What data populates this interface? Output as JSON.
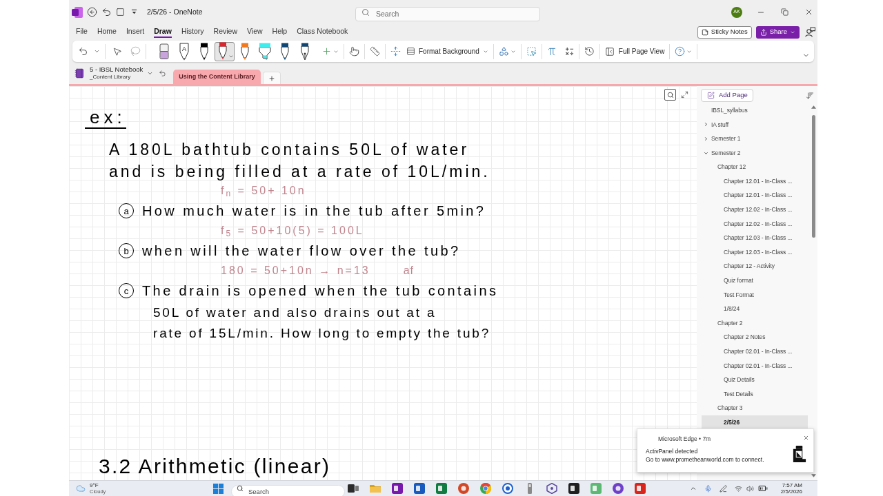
{
  "window": {
    "title": "2/5/26 - OneNote",
    "search_placeholder": "Search",
    "account_initials": "AK"
  },
  "menu_tabs": [
    {
      "label": "File",
      "selected": false
    },
    {
      "label": "Home",
      "selected": false
    },
    {
      "label": "Insert",
      "selected": false
    },
    {
      "label": "Draw",
      "selected": true
    },
    {
      "label": "History",
      "selected": false
    },
    {
      "label": "Review",
      "selected": false
    },
    {
      "label": "View",
      "selected": false
    },
    {
      "label": "Help",
      "selected": false
    },
    {
      "label": "Class Notebook",
      "selected": false
    }
  ],
  "header_buttons": {
    "sticky_notes": "Sticky Notes",
    "share": "Share"
  },
  "ribbon": {
    "pens": [
      {
        "kind": "eraser",
        "color": "#c9a3dc",
        "selected": false
      },
      {
        "kind": "text_pen",
        "label": "A",
        "selected": false
      },
      {
        "kind": "pen",
        "color": "#000000",
        "selected": false
      },
      {
        "kind": "pen",
        "color": "#e3232c",
        "selected": true
      },
      {
        "kind": "pen",
        "color": "#f07a1f",
        "selected": false
      },
      {
        "kind": "highlighter",
        "color": "#40ecec",
        "selected": false
      },
      {
        "kind": "pen",
        "color": "#0f4673",
        "selected": false
      },
      {
        "kind": "fountain_pen",
        "color": "#0f4673",
        "selected": false
      }
    ],
    "format_background": "Format Background",
    "full_page_view": "Full Page View"
  },
  "notebook": {
    "name": "5 - IBSL Notebook",
    "section_group": "_Content Library"
  },
  "section_tabs": [
    {
      "label": "Using the Content Library",
      "selected": true
    }
  ],
  "page_list": {
    "add_page": "Add Page",
    "items": [
      {
        "label": "IBSL_syllabus",
        "selected": false
      },
      {
        "label": "IA stuff",
        "selected": false,
        "expanded": false
      },
      {
        "label": "Semester 1",
        "selected": false,
        "expanded": false
      },
      {
        "label": "Semester 2",
        "selected": false,
        "expanded": true,
        "children": [
          {
            "label": "Chapter 12",
            "selected": false,
            "children": [
              {
                "label": "Chapter 12.01 - In-Class ...",
                "selected": false
              },
              {
                "label": "Chapter 12.01 - In-Class ...",
                "selected": false
              },
              {
                "label": "Chapter 12.02 - In-Class ...",
                "selected": false
              },
              {
                "label": "Chapter 12.02 - In-Class ...",
                "selected": false
              },
              {
                "label": "Chapter 12.03 - In-Class ...",
                "selected": false
              },
              {
                "label": "Chapter 12.03 - In-Class ...",
                "selected": false
              },
              {
                "label": "Chapter 12 - Activity",
                "selected": false
              },
              {
                "label": "Quiz format",
                "selected": false
              },
              {
                "label": "Test Format",
                "selected": false
              },
              {
                "label": "1/8/24",
                "selected": false
              }
            ]
          },
          {
            "label": "Chapter 2",
            "selected": false,
            "children": [
              {
                "label": "Chapter 2 Notes",
                "selected": false
              },
              {
                "label": "Chapter 02.01 - In-Class ...",
                "selected": false
              },
              {
                "label": "Chapter 02.01 - In-Class ...",
                "selected": false
              },
              {
                "label": "Quiz Details",
                "selected": false
              },
              {
                "label": "Test Details",
                "selected": false
              }
            ]
          },
          {
            "label": "Chapter 3",
            "selected": false,
            "children": [
              {
                "label": "2/5/26",
                "selected": true
              }
            ]
          }
        ]
      }
    ]
  },
  "ink": [
    {
      "kind": "title",
      "text": "ex:",
      "color": "#000000"
    },
    {
      "kind": "text",
      "text": "A 180L bathtub contains 50L of water",
      "color": "#000000"
    },
    {
      "kind": "text",
      "text": "and is being filled at a rate of 10L/min.",
      "color": "#000000"
    },
    {
      "kind": "answer",
      "text": "f$_{n}$ = 50+ 10n",
      "color": "#c0868f"
    },
    {
      "kind": "question",
      "marker": "a",
      "text": "How much water is in the tub after 5min?",
      "color": "#000000"
    },
    {
      "kind": "answer",
      "text": "f$_{5}$ = 50+10(5) = 100L",
      "color": "#c0868f"
    },
    {
      "kind": "question",
      "marker": "b",
      "text": "when will the water flow over the tub?",
      "color": "#000000"
    },
    {
      "kind": "answer",
      "text": "180 = 50+10n → n=13",
      "note": "af",
      "color": "#c0868f"
    },
    {
      "kind": "question",
      "marker": "c",
      "text": "The drain is opened when the tub contains",
      "color": "#000000"
    },
    {
      "kind": "continuation",
      "text": "50L of water and also drains out at a",
      "color": "#000000"
    },
    {
      "kind": "continuation",
      "text": "rate of 15L/min. How long to empty the tub?",
      "color": "#000000"
    },
    {
      "kind": "heading",
      "text": "3.2 Arithmetic (linear)",
      "color": "#000000"
    }
  ],
  "notification": {
    "source": "Microsoft Edge • 7m",
    "title": "ActivPanel detected",
    "body": "Go to www.prometheanworld.com to connect."
  },
  "taskbar": {
    "temperature": "9°F",
    "weather": "Cloudy",
    "search_placeholder": "Search",
    "time": "7:57 AM",
    "date": "2/5/2026"
  }
}
